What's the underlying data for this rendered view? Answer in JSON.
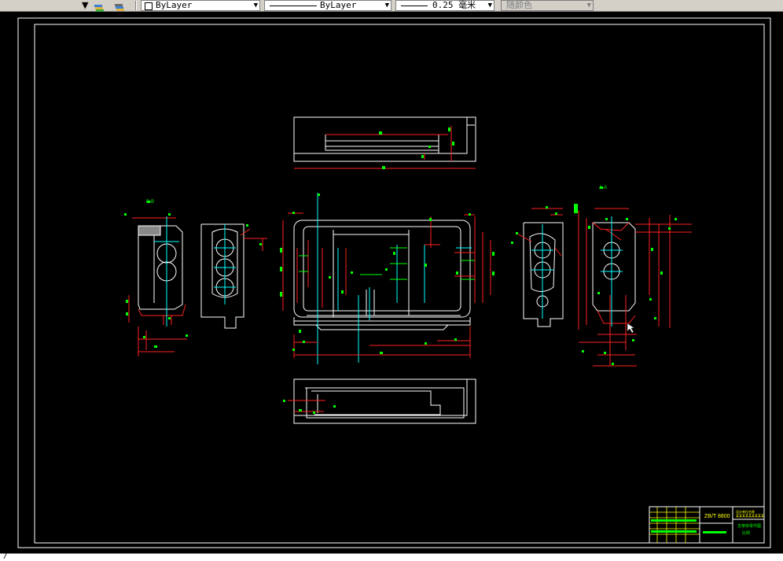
{
  "toolbar": {
    "layer_combo": {
      "value": "ByLayer"
    },
    "linetype_combo": {
      "value": "ByLayer"
    },
    "lineweight_combo": {
      "value": "0.25 毫米"
    },
    "plotstyle_combo": {
      "value": "随颜色"
    }
  },
  "title_block": {
    "code": "ZB/T 8800",
    "designer": "设计单位名称",
    "org": "某某某某某某某某某",
    "part": "支架体零件图",
    "scale": "比例"
  },
  "view_labels": {
    "left_section": "B-B",
    "right_section": "A-A"
  },
  "command": {
    "prompt": "/"
  },
  "colors": {
    "background": "#000000",
    "geometry": "#ffffff",
    "dimensions": "#ff2020",
    "dim_text": "#00ff00",
    "centerline": "#00ffff",
    "toolbar": "#d4d0c8"
  }
}
